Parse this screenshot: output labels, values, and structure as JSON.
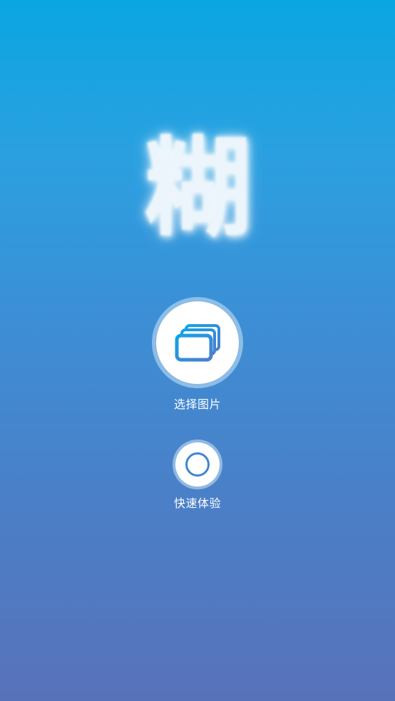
{
  "logo": {
    "glyph": "糊"
  },
  "actions": {
    "select_picture": {
      "label": "选择图片",
      "icon": "photo-stack-icon"
    },
    "quick_experience": {
      "label": "快速体验",
      "icon": "circle-icon"
    }
  },
  "colors": {
    "background_top": "#0aa6e2",
    "background_bottom": "#5872ba",
    "icon_accent": "#1e9be0",
    "ring_accent": "#3d86d2"
  }
}
